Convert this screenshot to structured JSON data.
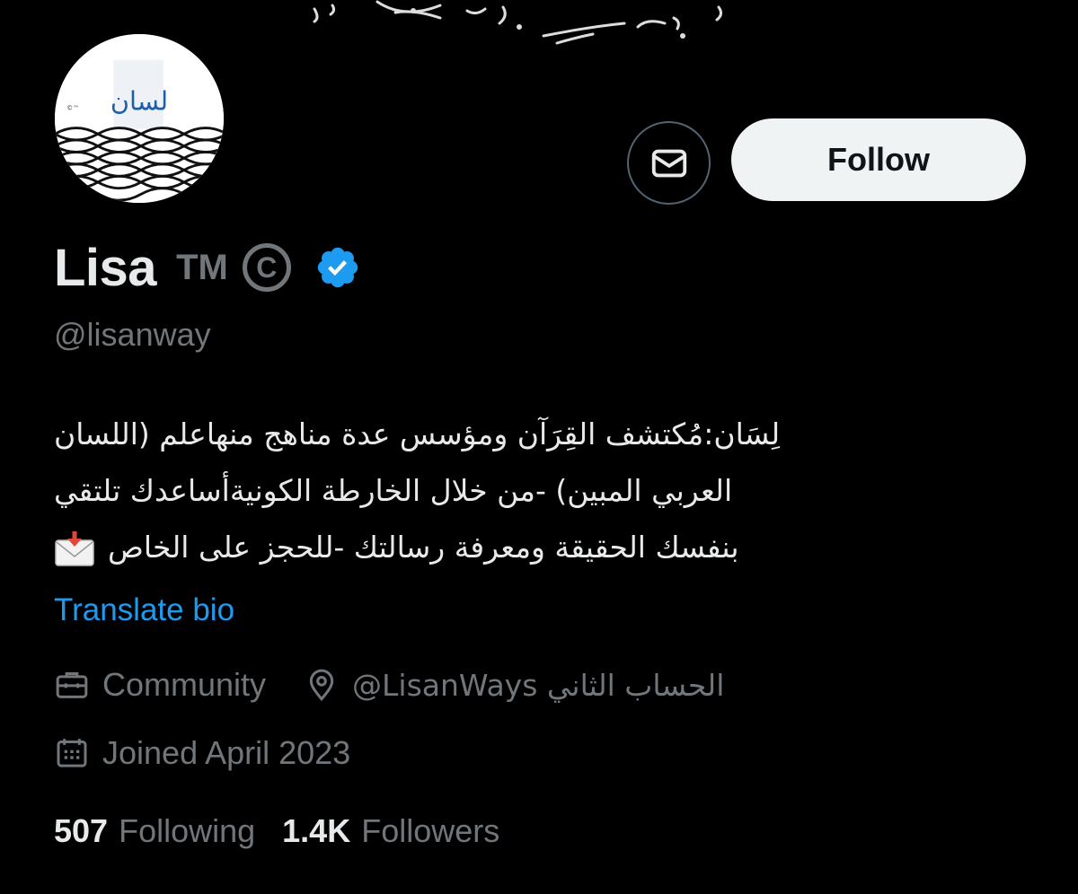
{
  "profile": {
    "avatar_logo_text": "لسان",
    "display_name": "Lisa",
    "name_suffix": "TM",
    "copyright_glyph": "C",
    "handle": "@lisanway",
    "bio_lines": [
      "لِسَان:مُكتشف القِرَآن ومؤسس عدة مناهج منهاعلم (اللسان",
      "العربي المبين) -من خلال الخارطة الكونيةأساعدك تلتقي",
      "بنفسك الحقيقة ومعرفة رسالتك -للحجز على الخاص"
    ],
    "translate_label": "Translate bio",
    "category": "Community",
    "location": "@LisanWays الحساب الثاني",
    "joined": "Joined April 2023",
    "following_count": "507",
    "following_label": "Following",
    "followers_count": "1.4K",
    "followers_label": "Followers"
  },
  "actions": {
    "follow_label": "Follow",
    "message_icon": "envelope-icon"
  },
  "colors": {
    "background": "#000000",
    "primary_text": "#e7e9ea",
    "secondary_text": "#71767b",
    "link": "#1d9bf0",
    "verified_badge": "#1d9bf0",
    "follow_bg": "#eff3f4"
  }
}
